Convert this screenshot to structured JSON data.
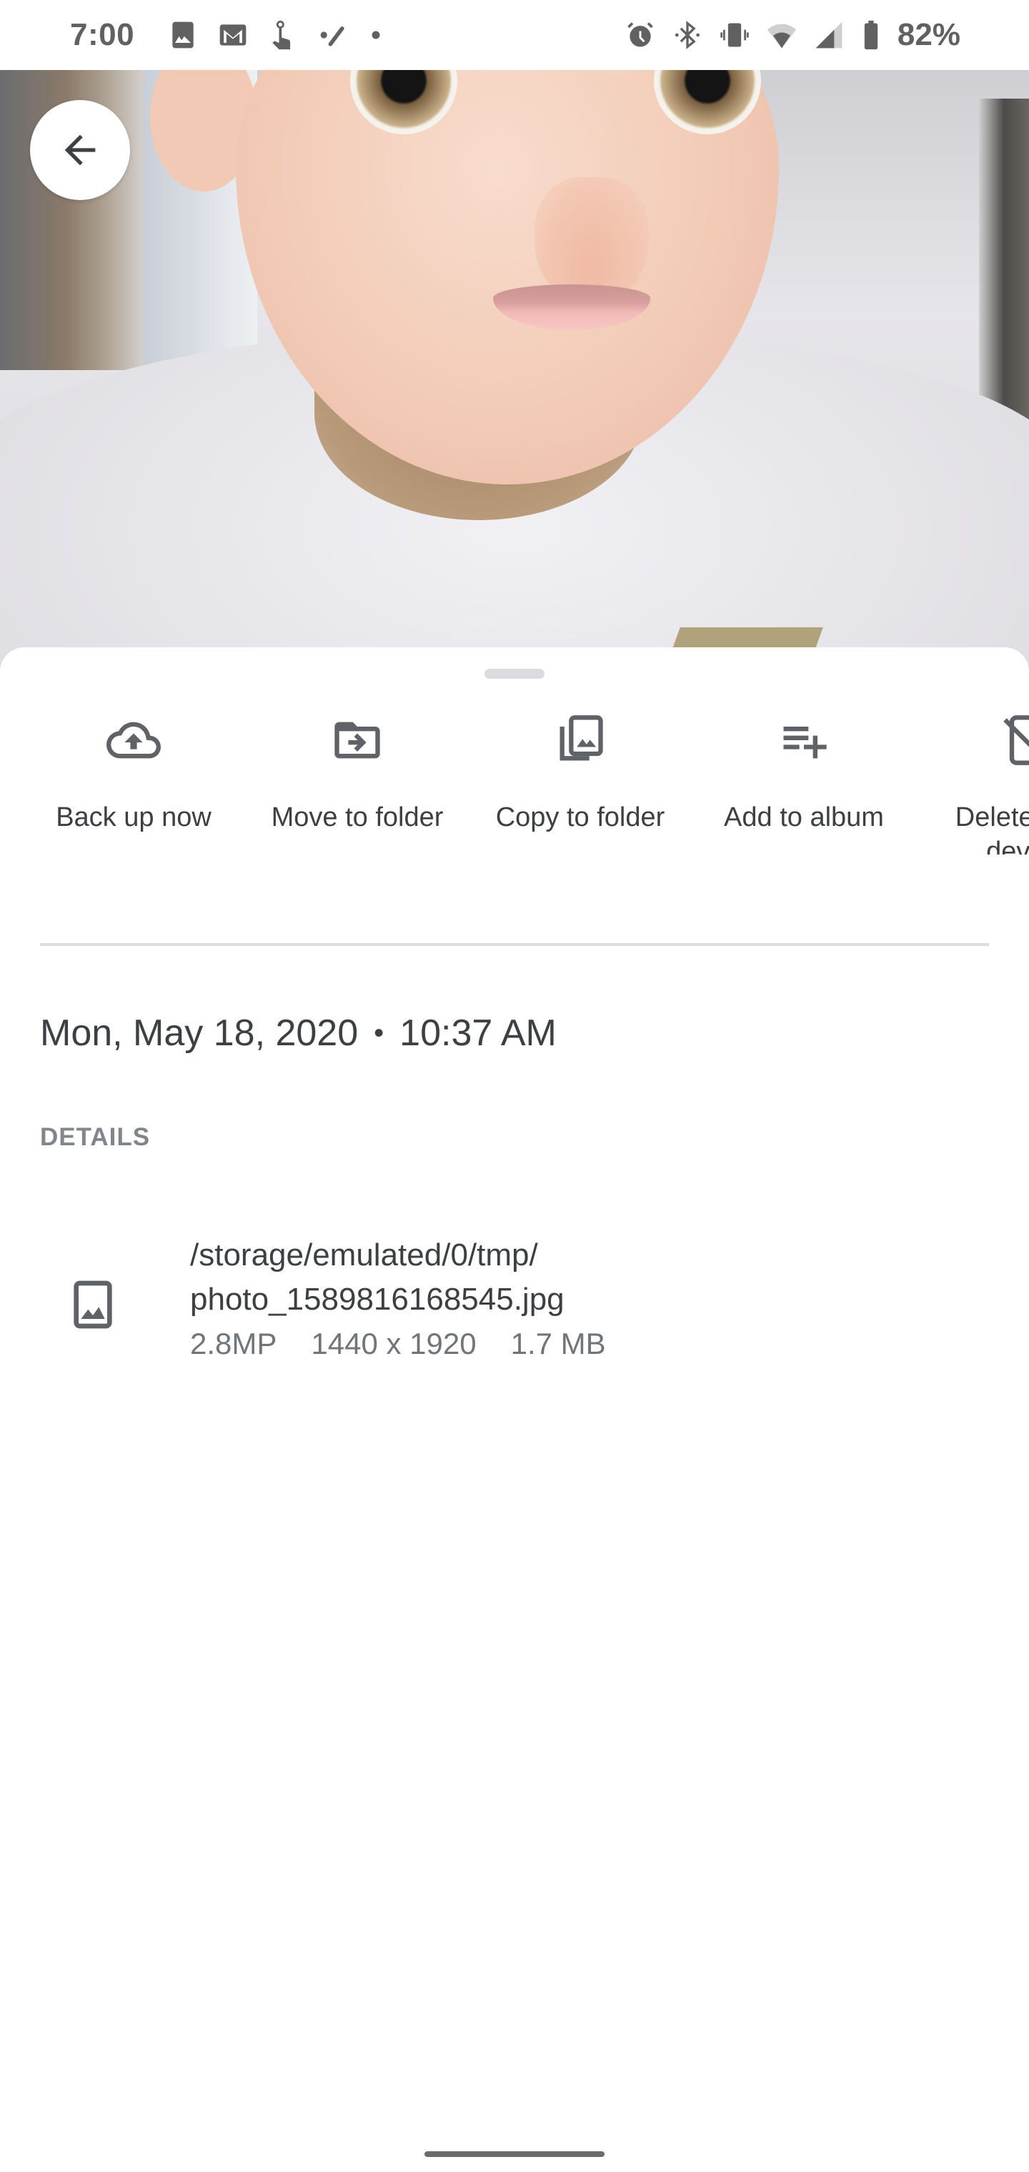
{
  "status_bar": {
    "time": "7:00",
    "left_icons": [
      "gallery-icon",
      "gmail-icon",
      "touch-gesture-icon",
      "edit-icon",
      "notification-dot-icon"
    ],
    "right_icons": [
      "alarm-icon",
      "bluetooth-icon",
      "vibrate-icon",
      "wifi-icon",
      "cellular-signal-icon",
      "battery-icon"
    ],
    "battery_percent": "82%"
  },
  "photo": {
    "description": "Selfie with animated cartoon face filter",
    "back_button_icon": "arrow-back-icon"
  },
  "actions": [
    {
      "icon": "cloud-upload-icon",
      "label": "Back up now"
    },
    {
      "icon": "move-to-folder-icon",
      "label": "Move to folder"
    },
    {
      "icon": "copy-to-folder-icon",
      "label": "Copy to folder"
    },
    {
      "icon": "playlist-add-icon",
      "label": "Add to album"
    },
    {
      "icon": "delete-from-device-icon",
      "label": "Delete from device"
    }
  ],
  "datetime": {
    "date": "Mon, May 18, 2020",
    "separator": "•",
    "time": "10:37 AM"
  },
  "details": {
    "header": "DETAILS",
    "file": {
      "icon": "image-icon",
      "path_line1": "/storage/emulated/0/tmp/",
      "path_line2": "photo_1589816168545.jpg",
      "megapixels": "2.8MP",
      "resolution": "1440 x 1920",
      "size": "1.7 MB"
    }
  },
  "colors": {
    "icon_gray": "#5f6368",
    "text_primary": "#3c4043",
    "text_secondary": "#70757a",
    "divider": "#dadce0"
  }
}
